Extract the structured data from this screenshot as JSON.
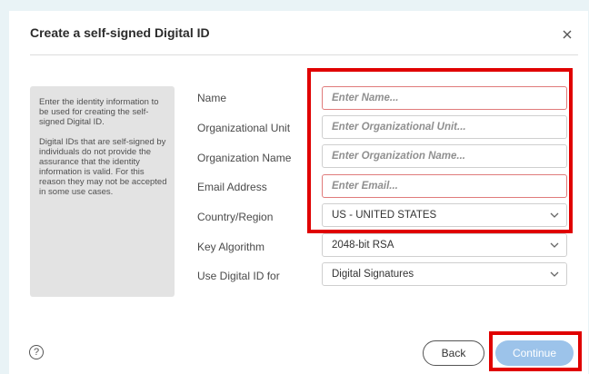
{
  "dialog": {
    "title": "Create a self-signed Digital ID",
    "close_icon": "close-icon"
  },
  "info": {
    "paragraph1": "Enter the identity information to be used for creating the self-signed Digital ID.",
    "paragraph2": "Digital IDs that are self-signed by individuals do not provide the assurance that the identity information is valid. For this reason they may not be accepted in some use cases."
  },
  "form": {
    "name": {
      "label": "Name",
      "placeholder": "Enter Name...",
      "value": ""
    },
    "org_unit": {
      "label": "Organizational Unit",
      "placeholder": "Enter Organizational Unit...",
      "value": ""
    },
    "org_name": {
      "label": "Organization Name",
      "placeholder": "Enter Organization Name...",
      "value": ""
    },
    "email": {
      "label": "Email Address",
      "placeholder": "Enter Email...",
      "value": ""
    },
    "country": {
      "label": "Country/Region",
      "selected": "US - UNITED STATES"
    },
    "key_algorithm": {
      "label": "Key Algorithm",
      "selected": "2048-bit RSA"
    },
    "use_for": {
      "label": "Use Digital ID for",
      "selected": "Digital Signatures"
    }
  },
  "footer": {
    "help_symbol": "?",
    "back_label": "Back",
    "continue_label": "Continue"
  },
  "colors": {
    "highlight": "#e00000",
    "continue_bg": "#9cc3ea",
    "required_border": "#e07b7b"
  }
}
